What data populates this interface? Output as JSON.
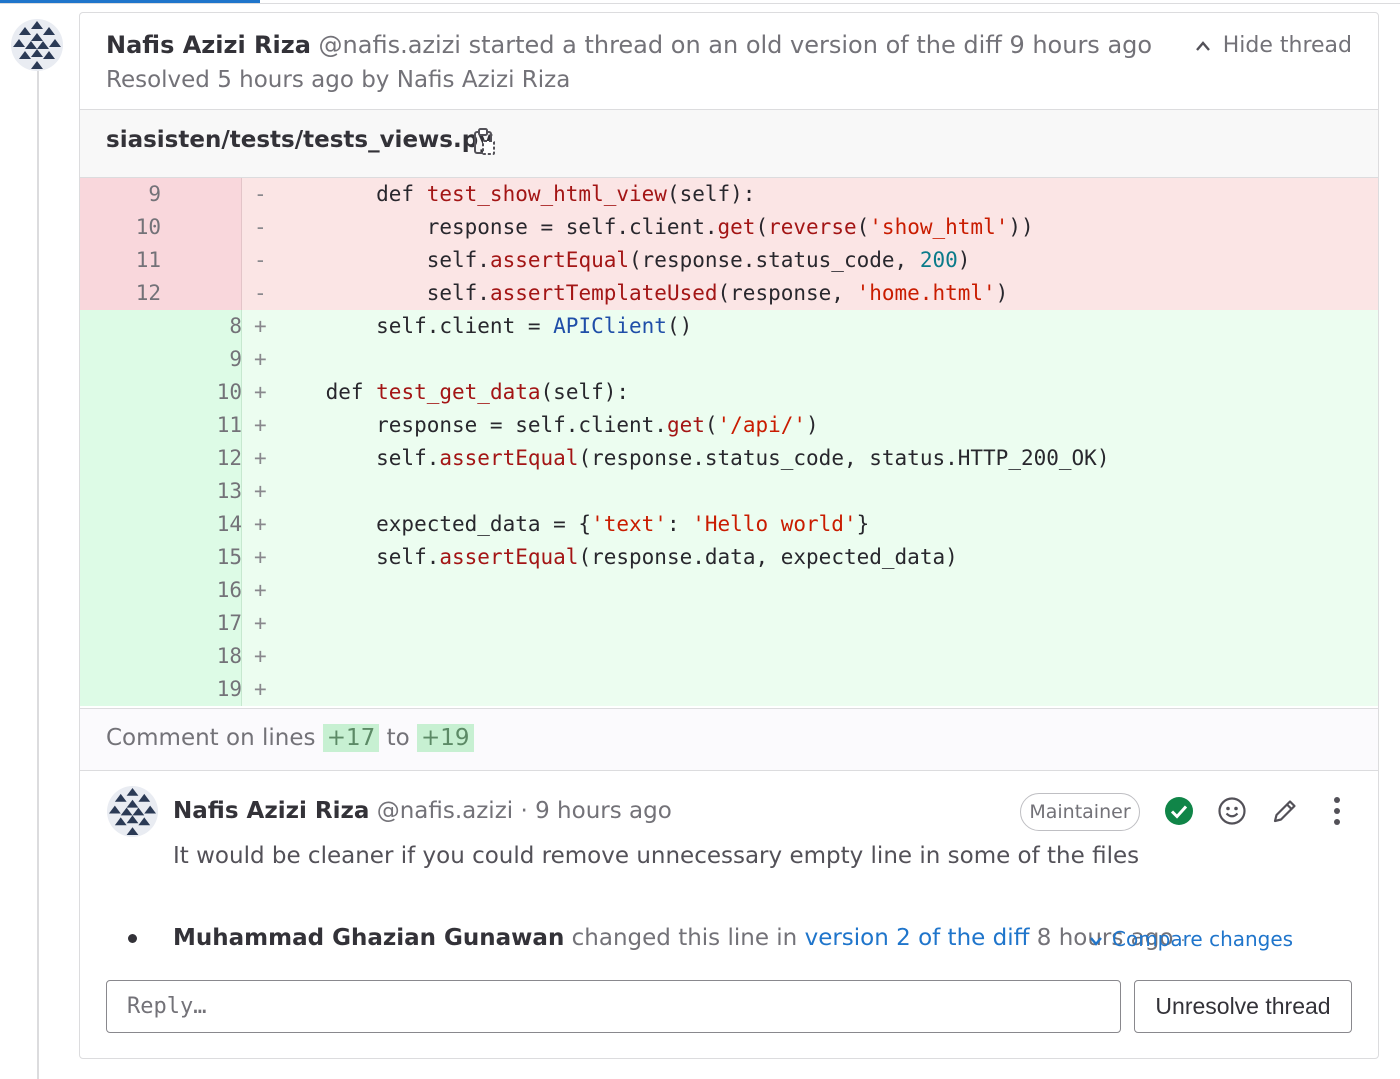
{
  "thread": {
    "author_name": "Nafis Azizi Riza",
    "author_handle": "@nafis.azizi",
    "action_text": "started a thread on an old version of the diff",
    "time": "9 hours ago",
    "resolved_text": "Resolved 5 hours ago by Nafis Azizi Riza",
    "hide_label": "Hide thread"
  },
  "file": {
    "path": "siasisten/tests/tests_views.py"
  },
  "diff": {
    "removed": [
      {
        "old": "9",
        "sign": "-"
      },
      {
        "old": "10",
        "sign": "-"
      },
      {
        "old": "11",
        "sign": "-"
      },
      {
        "old": "12",
        "sign": "-"
      }
    ],
    "added": [
      {
        "new": "8",
        "sign": "+"
      },
      {
        "new": "9",
        "sign": "+"
      },
      {
        "new": "10",
        "sign": "+"
      },
      {
        "new": "11",
        "sign": "+"
      },
      {
        "new": "12",
        "sign": "+"
      },
      {
        "new": "13",
        "sign": "+"
      },
      {
        "new": "14",
        "sign": "+"
      },
      {
        "new": "15",
        "sign": "+"
      },
      {
        "new": "16",
        "sign": "+"
      },
      {
        "new": "17",
        "sign": "+"
      },
      {
        "new": "18",
        "sign": "+"
      },
      {
        "new": "19",
        "sign": "+"
      }
    ],
    "code": {
      "r9_def": "        def ",
      "r9_fn": "test_show_html_view",
      "r9_rest": "(self):",
      "r10_a": "            response = self.client.",
      "r10_get": "get",
      "r10_p": "(",
      "r10_rev": "reverse",
      "r10_p2": "(",
      "r10_str": "'show_html'",
      "r10_end": "))",
      "r11_a": "            self.",
      "r11_fn": "assertEqual",
      "r11_b": "(response.status_code, ",
      "r11_num": "200",
      "r11_end": ")",
      "r12_a": "            self.",
      "r12_fn": "assertTemplateUsed",
      "r12_b": "(response, ",
      "r12_str": "'home.html'",
      "r12_end": ")",
      "a8_a": "        self.client = ",
      "a8_cls": "APIClient",
      "a8_end": "()",
      "a10_def": "    def ",
      "a10_fn": "test_get_data",
      "a10_rest": "(self):",
      "a11_a": "        response = self.client.",
      "a11_get": "get",
      "a11_p": "(",
      "a11_str": "'/api/'",
      "a11_end": ")",
      "a12_a": "        self.",
      "a12_fn": "assertEqual",
      "a12_b": "(response.status_code, status.HTTP_200_OK)",
      "a14_a": "        expected_data = {",
      "a14_s1": "'text'",
      "a14_c": ": ",
      "a14_s2": "'Hello world'",
      "a14_end": "}",
      "a15_a": "        self.",
      "a15_fn": "assertEqual",
      "a15_b": "(response.data, expected_data)"
    }
  },
  "comment_lines": {
    "prefix": "Comment on lines",
    "from": "+17",
    "to_word": "to",
    "to": "+19"
  },
  "reply": {
    "author_name": "Nafis Azizi Riza",
    "author_handle": "@nafis.azizi",
    "separator": "·",
    "time": "9 hours ago",
    "badge": "Maintainer",
    "body": "It would be cleaner if you could remove unnecessary empty line in some of the files"
  },
  "system_note": {
    "author": "Muhammad Ghazian Gunawan",
    "text": "changed this line in",
    "link": "version 2 of the diff",
    "time": "8 hours ago",
    "separator": "·",
    "compare_label": "Compare changes"
  },
  "reply_box": {
    "placeholder": "Reply…"
  },
  "buttons": {
    "unresolve": "Unresolve thread"
  },
  "colors": {
    "accent": "#1f75cb",
    "removed_bg": "#fbe5e5",
    "added_bg": "#ecfdf0",
    "resolved_green": "#108548"
  },
  "icons": [
    "chevron-up-icon",
    "copy-to-clipboard-icon",
    "resolve-check-icon",
    "emoji-icon",
    "edit-pencil-icon",
    "more-actions-icon",
    "chevron-down-icon"
  ]
}
